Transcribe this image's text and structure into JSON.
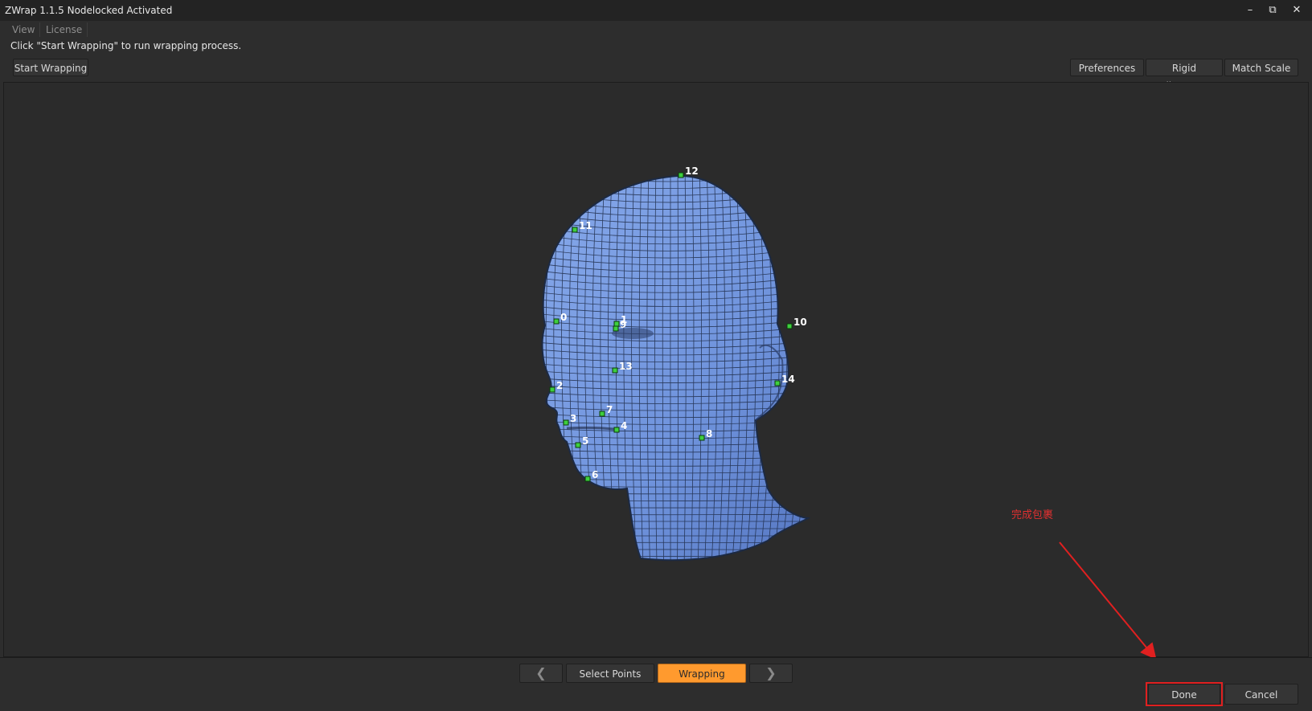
{
  "window": {
    "title": "ZWrap 1.1.5  Nodelocked Activated",
    "minimize_glyph": "–",
    "restore_glyph": "⧉",
    "close_glyph": "✕"
  },
  "menu": {
    "items": [
      "View",
      "License"
    ]
  },
  "hint": "Click \"Start Wrapping\" to run wrapping process.",
  "toolbar": {
    "start_wrapping": "Start Wrapping",
    "preferences": "Preferences",
    "rigid_alignment": "Rigid Alignment",
    "match_scale": "Match Scale"
  },
  "landmarks": [
    "0",
    "1",
    "2",
    "3",
    "4",
    "5",
    "6",
    "7",
    "8",
    "9",
    "10",
    "11",
    "12",
    "13",
    "14"
  ],
  "steps": {
    "prev_glyph": "❮",
    "next_glyph": "❯",
    "select_points": "Select Points",
    "wrapping": "Wrapping"
  },
  "actions": {
    "done": "Done",
    "cancel": "Cancel"
  },
  "annotation": {
    "text": "完成包裹",
    "color": "#e03030"
  },
  "colors": {
    "accent": "#ff9a2e",
    "mesh": "#6f95dd",
    "landmark": "#3ecf3e",
    "background": "#2d2d2d"
  }
}
